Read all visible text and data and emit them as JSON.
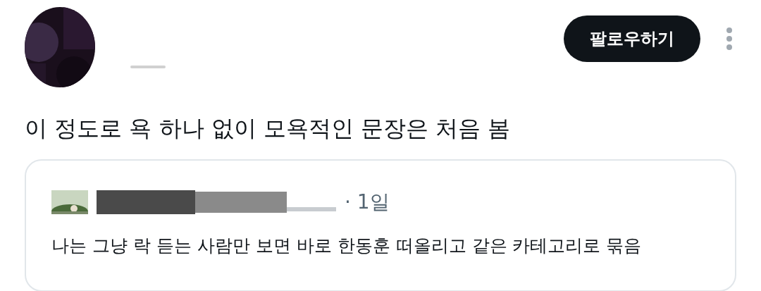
{
  "author": {
    "follow_button": "팔로우하기"
  },
  "tweet": {
    "text": "이 정도로 욕 하나 없이 모욕적인 문장은 처음 봄"
  },
  "quoted_tweet": {
    "time": "· 1일",
    "text": "나는 그냥 락 듣는 사람만 보면 바로 한동훈 떠올리고 같은 카테고리로 묶음"
  }
}
